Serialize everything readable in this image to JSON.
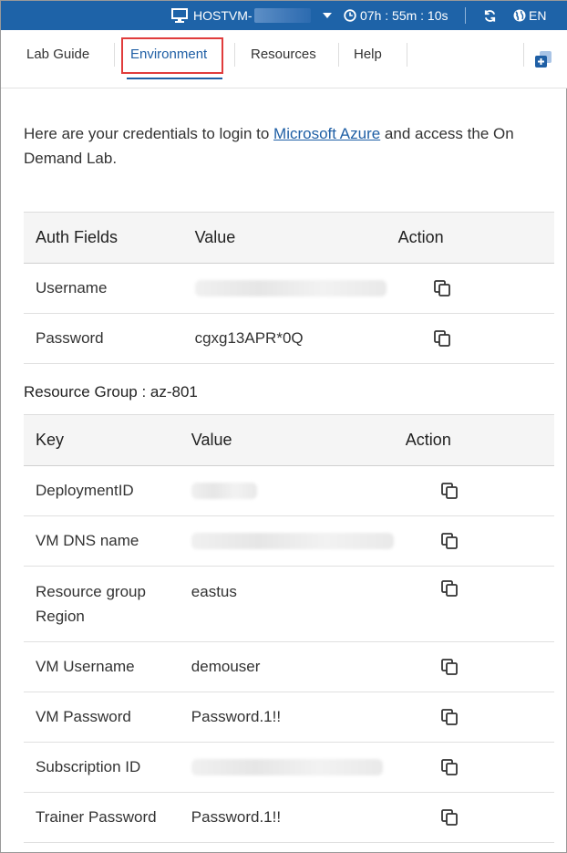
{
  "topbar": {
    "host_label": "HOSTVM-",
    "timer": "07h : 55m : 10s",
    "language": "EN",
    "monitor_icon": "monitor-icon",
    "clock_icon": "clock-icon",
    "refresh_icon": "refresh-icon",
    "globe_icon": "globe-icon"
  },
  "tabs": [
    {
      "label": "Lab Guide"
    },
    {
      "label": "Environment"
    },
    {
      "label": "Resources"
    },
    {
      "label": "Help"
    }
  ],
  "intro": {
    "before": "Here are your credentials to login to ",
    "link": "Microsoft Azure",
    "after": " and access the On Demand Lab."
  },
  "auth_table": {
    "headers": [
      "Auth Fields",
      "Value",
      "Action"
    ],
    "rows": [
      {
        "field": "Username",
        "value": ""
      },
      {
        "field": "Password",
        "value": "cgxg13APR*0Q"
      }
    ]
  },
  "resource_group": {
    "label": "Resource Group : az-801",
    "headers": [
      "Key",
      "Value",
      "Action"
    ],
    "rows": [
      {
        "key": "DeploymentID",
        "value": ""
      },
      {
        "key": "VM DNS name",
        "value": ""
      },
      {
        "key": "Resource group Region",
        "value": "eastus"
      },
      {
        "key": "VM Username",
        "value": "demouser"
      },
      {
        "key": "VM Password",
        "value": "Password.1!!"
      },
      {
        "key": "Subscription ID",
        "value": ""
      },
      {
        "key": "Trainer Password",
        "value": "Password.1!!"
      }
    ]
  },
  "colors": {
    "topbar": "#1e63a8",
    "accent": "#1f5fa5",
    "highlight": "#e03c3c"
  }
}
